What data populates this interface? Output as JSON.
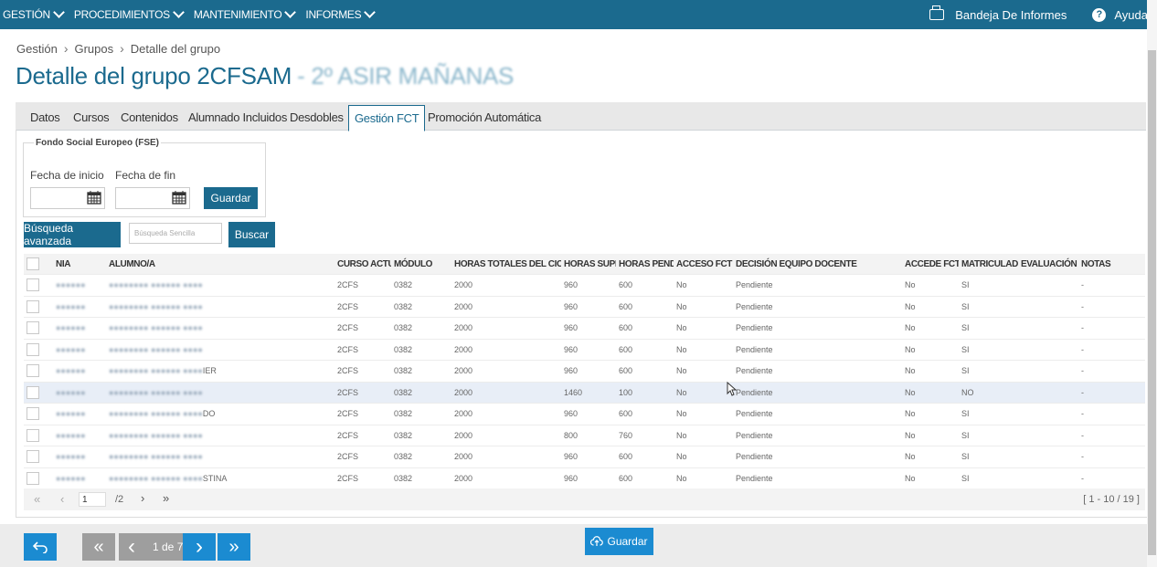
{
  "menu": [
    {
      "label": "GESTIÓN"
    },
    {
      "label": "PROCEDIMIENTOS"
    },
    {
      "label": "MANTENIMIENTO"
    },
    {
      "label": "INFORMES"
    }
  ],
  "topright": {
    "reports": "Bandeja De Informes",
    "help": "Ayuda",
    "reports_icon": "printer-icon",
    "help_icon": "help-icon"
  },
  "breadcrumb": [
    "Gestión",
    "Grupos",
    "Detalle del grupo"
  ],
  "page_title": "Detalle del grupo 2CFSAM",
  "page_title_suffix": "- 2º ASIR MAÑANAS",
  "tabs": [
    {
      "label": "Datos"
    },
    {
      "label": "Cursos"
    },
    {
      "label": "Contenidos"
    },
    {
      "label": "Alumnado Incluidos"
    },
    {
      "label": "Desdobles"
    },
    {
      "label": "Gestión FCT"
    },
    {
      "label": "Promoción Automática"
    }
  ],
  "fse": {
    "legend": "Fondo Social Europeo (FSE)",
    "start_label": "Fecha de inicio",
    "end_label": "Fecha de fin",
    "start_value": "",
    "end_value": "",
    "save": "Guardar"
  },
  "search": {
    "advanced": "Búsqueda avanzada",
    "placeholder": "Búsqueda Sencilla",
    "button": "Buscar"
  },
  "table": {
    "headers": [
      "NIA",
      "ALUMNO/A",
      "CURSO ACTUAL",
      "MÓDULO",
      "HORAS TOTALES DEL CICLO",
      "HORAS SUPERA",
      "HORAS PENDIE",
      "ACCESO FCT",
      "DECISIÓN EQUIPO DOCENTE",
      "ACCEDE FCT",
      "MATRICULADO",
      "EVALUACIÓN",
      "NOTAS"
    ],
    "rows": [
      {
        "nia": "",
        "alumno": "",
        "curso": "2CFS",
        "modulo": "0382",
        "horas_totales": "2000",
        "horas_superadas": "960",
        "horas_pendientes": "600",
        "acceso": "No",
        "decision": "Pendiente",
        "accede": "No",
        "matriculado": "SI",
        "evaluacion": "",
        "notas": "-"
      },
      {
        "nia": "",
        "alumno": "",
        "curso": "2CFS",
        "modulo": "0382",
        "horas_totales": "2000",
        "horas_superadas": "960",
        "horas_pendientes": "600",
        "acceso": "No",
        "decision": "Pendiente",
        "accede": "No",
        "matriculado": "SI",
        "evaluacion": "",
        "notas": "-"
      },
      {
        "nia": "",
        "alumno": "",
        "curso": "2CFS",
        "modulo": "0382",
        "horas_totales": "2000",
        "horas_superadas": "960",
        "horas_pendientes": "600",
        "acceso": "No",
        "decision": "Pendiente",
        "accede": "No",
        "matriculado": "SI",
        "evaluacion": "",
        "notas": "-"
      },
      {
        "nia": "",
        "alumno": "",
        "curso": "2CFS",
        "modulo": "0382",
        "horas_totales": "2000",
        "horas_superadas": "960",
        "horas_pendientes": "600",
        "acceso": "No",
        "decision": "Pendiente",
        "accede": "No",
        "matriculado": "SI",
        "evaluacion": "",
        "notas": "-"
      },
      {
        "nia": "",
        "alumno": "IER",
        "curso": "2CFS",
        "modulo": "0382",
        "horas_totales": "2000",
        "horas_superadas": "960",
        "horas_pendientes": "600",
        "acceso": "No",
        "decision": "Pendiente",
        "accede": "No",
        "matriculado": "SI",
        "evaluacion": "",
        "notas": "-"
      },
      {
        "nia": "",
        "alumno": "",
        "curso": "2CFS",
        "modulo": "0382",
        "horas_totales": "2000",
        "horas_superadas": "1460",
        "horas_pendientes": "100",
        "acceso": "No",
        "decision": "Pendiente",
        "accede": "No",
        "matriculado": "NO",
        "evaluacion": "",
        "notas": "-"
      },
      {
        "nia": "",
        "alumno": "DO",
        "curso": "2CFS",
        "modulo": "0382",
        "horas_totales": "2000",
        "horas_superadas": "960",
        "horas_pendientes": "600",
        "acceso": "No",
        "decision": "Pendiente",
        "accede": "No",
        "matriculado": "SI",
        "evaluacion": "",
        "notas": "-"
      },
      {
        "nia": "",
        "alumno": "",
        "curso": "2CFS",
        "modulo": "0382",
        "horas_totales": "2000",
        "horas_superadas": "800",
        "horas_pendientes": "760",
        "acceso": "No",
        "decision": "Pendiente",
        "accede": "No",
        "matriculado": "SI",
        "evaluacion": "",
        "notas": "-"
      },
      {
        "nia": "",
        "alumno": "",
        "curso": "2CFS",
        "modulo": "0382",
        "horas_totales": "2000",
        "horas_superadas": "960",
        "horas_pendientes": "600",
        "acceso": "No",
        "decision": "Pendiente",
        "accede": "No",
        "matriculado": "SI",
        "evaluacion": "",
        "notas": "-"
      },
      {
        "nia": "",
        "alumno": "STINA",
        "curso": "2CFS",
        "modulo": "0382",
        "horas_totales": "2000",
        "horas_superadas": "960",
        "horas_pendientes": "600",
        "acceso": "No",
        "decision": "Pendiente",
        "accede": "No",
        "matriculado": "SI",
        "evaluacion": "",
        "notas": "-"
      }
    ],
    "highlighted_row": 6
  },
  "pager": {
    "first": "«",
    "prev": "‹",
    "current": "1",
    "total": "/2",
    "next": "›",
    "last": "»",
    "range": "[ 1 - 10 / 19 ]"
  },
  "footer": {
    "back_icon": "return-icon",
    "first": "«",
    "prev": "‹",
    "position": "1 de 7",
    "next": "›",
    "last": "»",
    "save": "Guardar",
    "save_icon": "cloud-upload-icon"
  },
  "colors": {
    "primary": "#1b6a8e",
    "footer_button": "#1b8bd1",
    "highlight_row": "#e8eef7"
  }
}
